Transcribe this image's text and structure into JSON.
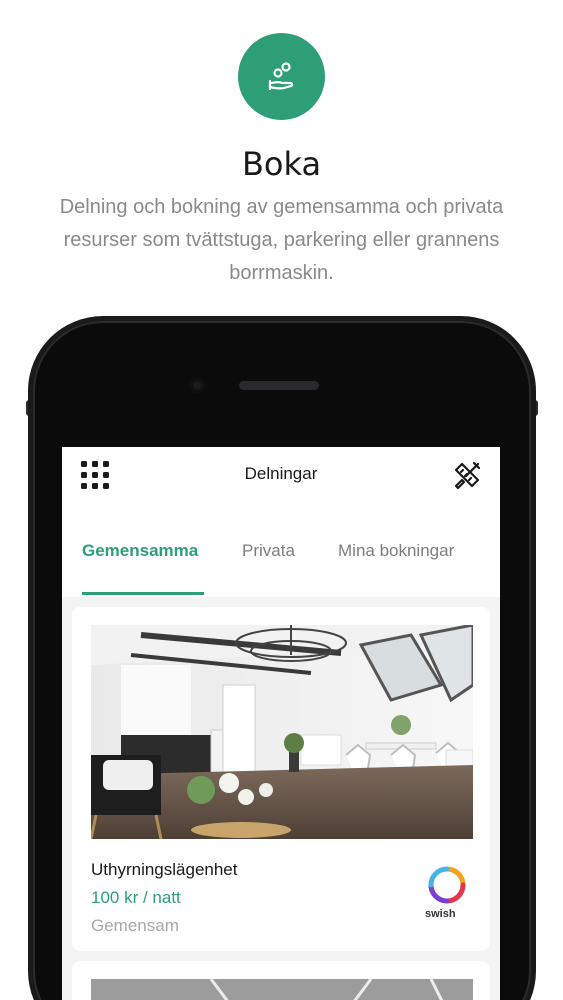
{
  "hero": {
    "icon": "hand-coins-icon",
    "title": "Boka",
    "description": "Delning och bokning av gemensamma och privata resurser som tvättstuga, parkering eller grannens borrmaskin."
  },
  "app": {
    "title": "Delningar",
    "menu_icon": "grid-menu-icon",
    "tools_icon": "tools-icon",
    "tabs": [
      {
        "label": "Gemensamma",
        "active": true
      },
      {
        "label": "Privata",
        "active": false
      },
      {
        "label": "Mina bokningar",
        "active": false
      }
    ],
    "items": [
      {
        "title": "Uthyrningslägenhet",
        "price": "100 kr / natt",
        "category": "Gemensam",
        "payment": "swish"
      }
    ]
  },
  "colors": {
    "accent": "#2e9e76",
    "muted": "#8a8a8a"
  }
}
